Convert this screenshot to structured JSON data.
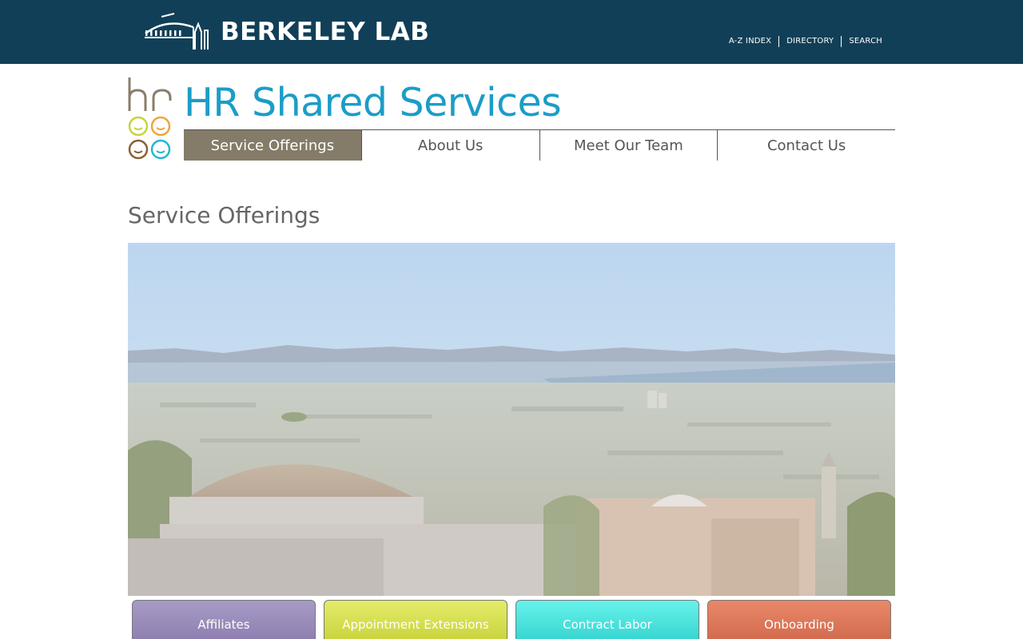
{
  "header": {
    "brand_name": "BERKELEY LAB",
    "utility_links": [
      "A-Z INDEX",
      "DIRECTORY",
      "SEARCH"
    ]
  },
  "site": {
    "title": "HR Shared Services"
  },
  "nav": {
    "items": [
      {
        "label": "Service Offerings",
        "active": true
      },
      {
        "label": "About Us",
        "active": false
      },
      {
        "label": "Meet Our Team",
        "active": false
      },
      {
        "label": "Contact Us",
        "active": false
      }
    ]
  },
  "main": {
    "page_title": "Service Offerings"
  },
  "tiles": [
    {
      "label": "Affiliates",
      "color": "#8a7aad"
    },
    {
      "label": "Appointment Extensions",
      "color": "#c5cf35"
    },
    {
      "label": "Contract Labor",
      "color": "#2ed0cc"
    },
    {
      "label": "Onboarding",
      "color": "#cf6649"
    }
  ],
  "colors": {
    "header_bg": "#113f57",
    "title_blue": "#1b9dc7",
    "nav_active": "#847b68"
  }
}
